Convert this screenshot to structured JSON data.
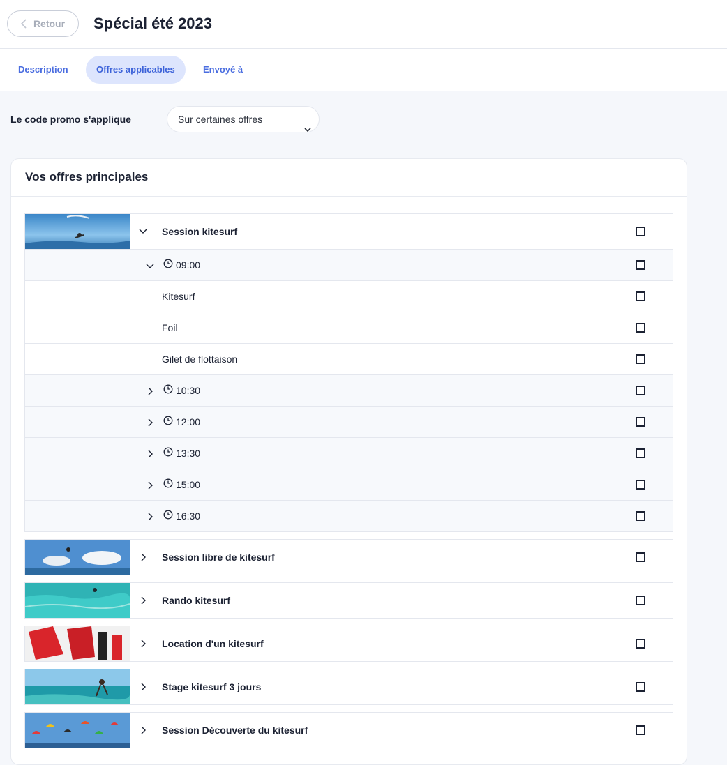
{
  "header": {
    "back_label": "Retour",
    "title": "Spécial été 2023"
  },
  "tabs": [
    {
      "label": "Description",
      "active": false
    },
    {
      "label": "Offres applicables",
      "active": true
    },
    {
      "label": "Envoyé à",
      "active": false
    }
  ],
  "promo": {
    "label": "Le code promo s'applique",
    "selected_option": "Sur certaines offres"
  },
  "main_offers": {
    "title": "Vos offres principales",
    "expanded_offer": {
      "name": "Session kitesurf",
      "expanded_slot": {
        "time": "09:00",
        "items": [
          "Kitesurf",
          "Foil",
          "Gilet de flottaison"
        ]
      },
      "other_slots": [
        "10:30",
        "12:00",
        "13:30",
        "15:00",
        "16:30"
      ]
    },
    "offers": [
      "Session libre de kitesurf",
      "Rando kitesurf",
      "Location d'un kitesurf",
      "Stage kitesurf 3 jours",
      "Session Découverte du kitesurf"
    ]
  },
  "icons": {
    "back": "chevron-left-icon",
    "select": "chevron-down-icon",
    "expand": "chevron-right-icon",
    "collapse": "chevron-down-icon",
    "time": "clock-icon"
  },
  "colors": {
    "accent": "#4a6de0",
    "active_tab_bg": "#dde5fd",
    "text": "#1c2233",
    "border": "#e4e7ee"
  }
}
